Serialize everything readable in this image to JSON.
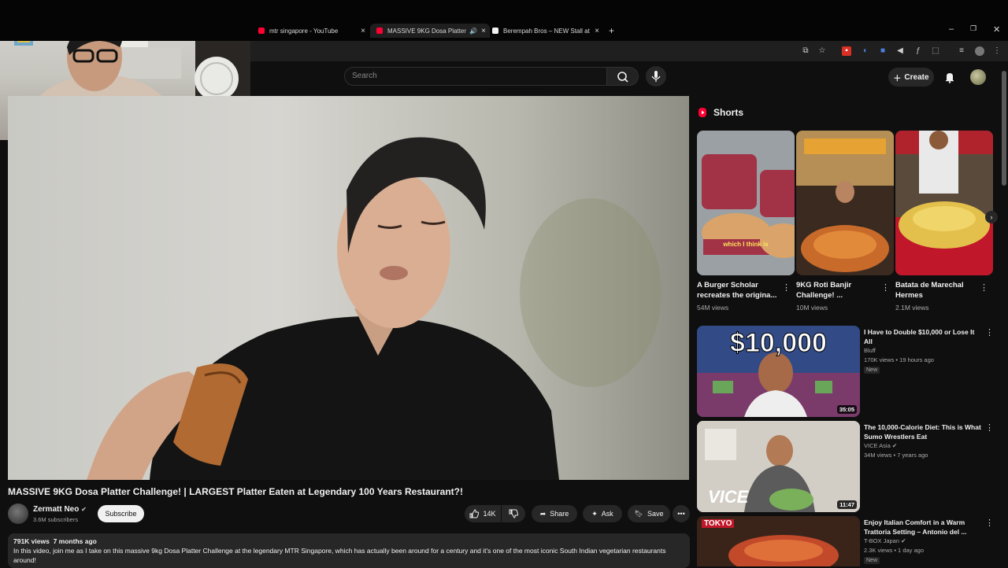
{
  "browser": {
    "tabs": [
      {
        "title": "mtr singapore - YouTube",
        "active": false
      },
      {
        "title": "MASSIVE 9KG Dosa Platter",
        "active": true
      },
      {
        "title": "Berempah Bros – NEW Stall at",
        "active": false
      }
    ],
    "new_tab": "+",
    "close_glyph": "×"
  },
  "header": {
    "search_placeholder": "Search",
    "create_label": "Create"
  },
  "video": {
    "title": "MASSIVE 9KG Dosa Platter Challenge! | LARGEST Platter Eaten at Legendary 100 Years Restaurant?!",
    "channel": "Zermatt Neo",
    "subscribers": "3.6M subscribers",
    "subscribe_label": "Subscribe",
    "likes": "14K",
    "share_label": "Share",
    "ask_label": "Ask",
    "save_label": "Save",
    "views": "791K views",
    "age": "7 months ago",
    "description": "In this video, join me as I take on this massive 9kg Dosa Platter Challenge at the legendary MTR Singapore, which has actually been around for a century and it's one of the most iconic South Indian vegetarian restaurants around!"
  },
  "shorts": {
    "heading": "Shorts",
    "items": [
      {
        "title": "A Burger Scholar recreates the origina...",
        "views": "54M views",
        "caption": "which I think is"
      },
      {
        "title": "9KG Roti Banjir Challenge! ...",
        "views": "10M views"
      },
      {
        "title": "Batata de Marechal Hermes",
        "views": "2.1M views"
      }
    ]
  },
  "recommended": [
    {
      "title": "I Have to Double $10,000 or Lose It All",
      "channel": "Bluff",
      "meta": "170K views • 19 hours ago",
      "badge": "New",
      "duration": "35:05",
      "thumb_text": "$10,000"
    },
    {
      "title": "The 10,000-Calorie Diet: This is What Sumo Wrestlers Eat",
      "channel": "VICE Asia",
      "meta": "34M views • 7 years ago",
      "duration": "11:47",
      "thumb_text": "VICE"
    },
    {
      "title": "Enjoy Italian Comfort in a Warm Trattoria Setting – Antonio del ...",
      "channel": "T-BOX Japan",
      "meta": "2.3K views • 1 day ago",
      "badge": "New",
      "thumb_text": "TOKYO"
    }
  ],
  "colors": {
    "accent_red": "#ff0033",
    "background": "#0f0f0f",
    "pill": "#272727"
  }
}
